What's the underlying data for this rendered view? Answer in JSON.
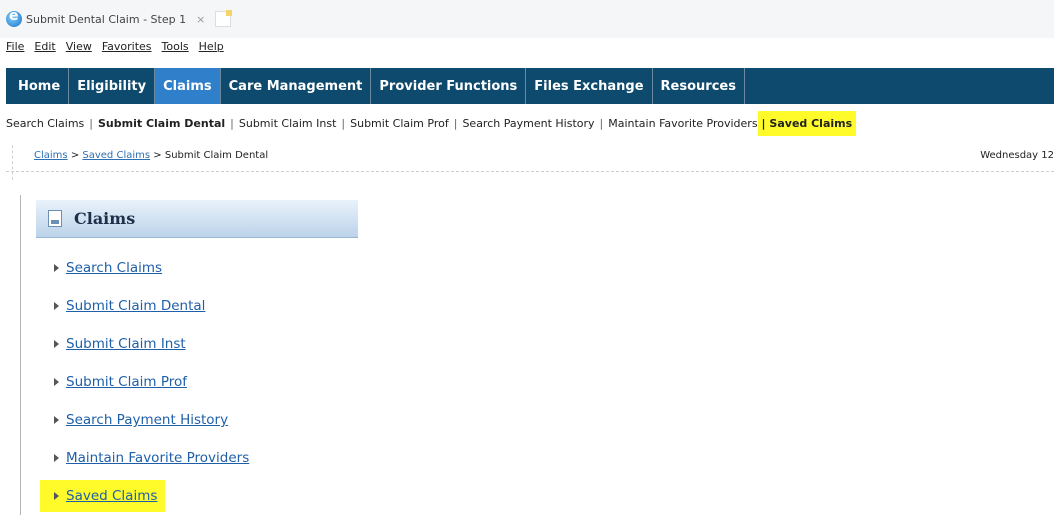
{
  "browser": {
    "tab_title": "Submit Dental Claim - Step 1",
    "tab_close": "×",
    "menu": [
      "File",
      "Edit",
      "View",
      "Favorites",
      "Tools",
      "Help"
    ]
  },
  "topnav": {
    "items": [
      "Home",
      "Eligibility",
      "Claims",
      "Care Management",
      "Provider Functions",
      "Files Exchange",
      "Resources"
    ],
    "active": "Claims",
    "colors": {
      "bar": "#0e4a6e",
      "active": "#2f7fcb"
    }
  },
  "subnav": {
    "items": [
      "Search Claims",
      "Submit Claim Dental",
      "Submit Claim Inst",
      "Submit Claim Prof",
      "Search Payment History",
      "Maintain Favorite Providers",
      "Saved Claims"
    ],
    "separator": "|",
    "highlight_color": "#fffb2a"
  },
  "breadcrumb": {
    "items": [
      "Claims",
      "Saved Claims",
      "Submit Claim Dental"
    ],
    "separator": ">"
  },
  "date_text": "Wednesday 12",
  "sidebar": {
    "title": "Claims",
    "items": [
      "Search Claims",
      "Submit Claim Dental",
      "Submit Claim Inst",
      "Submit Claim Prof",
      "Search Payment History",
      "Maintain Favorite Providers",
      "Saved Claims"
    ]
  }
}
